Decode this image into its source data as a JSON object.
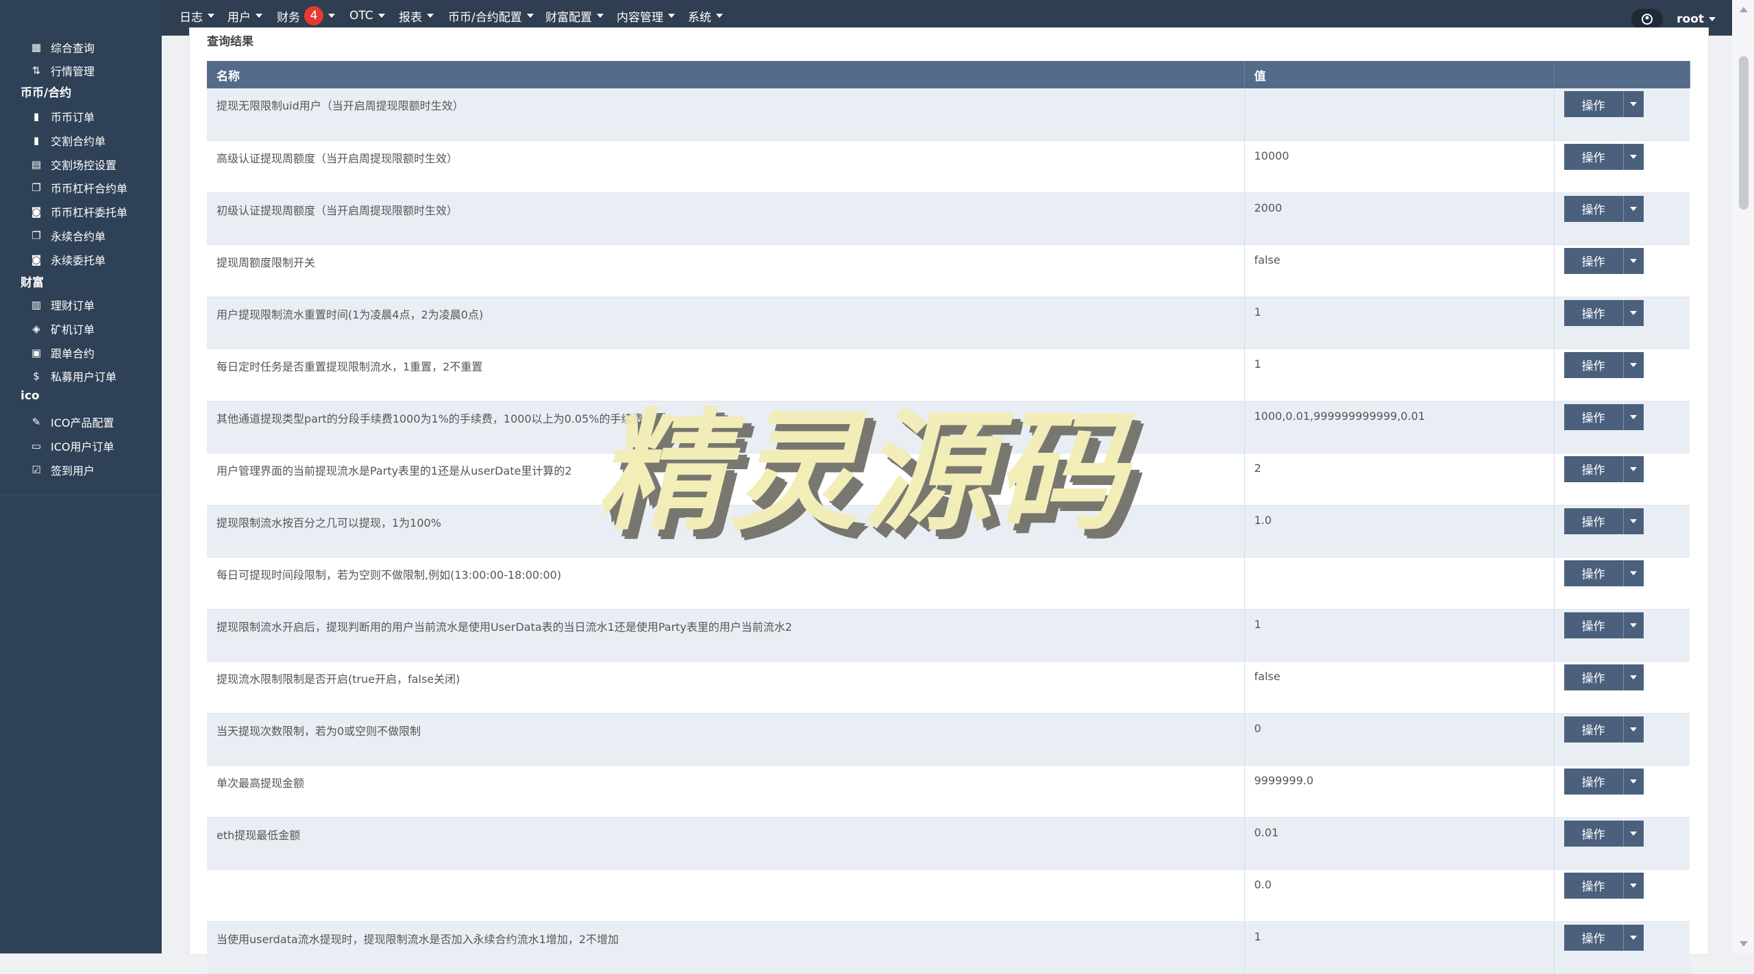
{
  "sidebar": {
    "items_top": [
      {
        "label": "综合查询",
        "icon": "grid-icon"
      },
      {
        "label": "行情管理",
        "icon": "sort-icon"
      }
    ],
    "section_coin": "币币/合约",
    "items_coin": [
      {
        "label": "币币订单",
        "icon": "bookmark-icon"
      },
      {
        "label": "交割合约单",
        "icon": "bookmark-icon"
      },
      {
        "label": "交割场控设置",
        "icon": "file-icon"
      },
      {
        "label": "币币杠杆合约单",
        "icon": "copy-icon"
      },
      {
        "label": "币币杠杆委托单",
        "icon": "file-clock-icon"
      },
      {
        "label": "永续合约单",
        "icon": "copy-icon"
      },
      {
        "label": "永续委托单",
        "icon": "file-clock-icon"
      }
    ],
    "section_wealth": "财富",
    "items_wealth": [
      {
        "label": "理财订单",
        "icon": "database-icon"
      },
      {
        "label": "矿机订单",
        "icon": "layers-icon"
      },
      {
        "label": "跟单合约",
        "icon": "calendar-icon"
      },
      {
        "label": "私募用户订单",
        "icon": "dollar-icon"
      }
    ],
    "section_ico": "ico",
    "items_ico": [
      {
        "label": "ICO产品配置",
        "icon": "edit-icon"
      },
      {
        "label": "ICO用户订单",
        "icon": "message-icon"
      },
      {
        "label": "签到用户",
        "icon": "check-edit-icon"
      }
    ]
  },
  "topnav": {
    "menus": [
      "日志",
      "用户",
      "财务",
      "OTC",
      "报表",
      "币币/合约配置",
      "财富配置",
      "内容管理",
      "系统"
    ],
    "finance_badge": "4",
    "user": "root",
    "avatar_icon": "user-circle-icon"
  },
  "results": {
    "title": "查询结果",
    "col_name": "名称",
    "col_value": "值",
    "col_action": "",
    "action_label": "操作",
    "rows": [
      {
        "name": "提现无限限制uid用户（当开启周提现限额时生效）",
        "value": ""
      },
      {
        "name": "高级认证提现周额度（当开启周提现限额时生效）",
        "value": "10000"
      },
      {
        "name": "初级认证提现周额度（当开启周提现限额时生效）",
        "value": "2000"
      },
      {
        "name": "提现周额度限制开关",
        "value": "false"
      },
      {
        "name": "用户提现限制流水重置时间(1为凌晨4点，2为凌晨0点)",
        "value": "1"
      },
      {
        "name": "每日定时任务是否重置提现限制流水，1重置，2不重置",
        "value": "1"
      },
      {
        "name": "其他通道提现类型part的分段手续费1000为1%的手续费，1000以上为0.05%的手续费",
        "value": "1000,0.01,999999999999,0.01"
      },
      {
        "name": "用户管理界面的当前提现流水是Party表里的1还是从userDate里计算的2",
        "value": "2"
      },
      {
        "name": "提现限制流水按百分之几可以提现，1为100%",
        "value": "1.0"
      },
      {
        "name": "每日可提现时间段限制，若为空则不做限制,例如(13:00:00-18:00:00)",
        "value": ""
      },
      {
        "name": "提现限制流水开启后，提现判断用的用户当前流水是使用UserData表的当日流水1还是使用Party表里的用户当前流水2",
        "value": "1"
      },
      {
        "name": "提现流水限制限制是否开启(true开启，false关闭)",
        "value": "false"
      },
      {
        "name": "当天提现次数限制，若为0或空则不做限制",
        "value": "0"
      },
      {
        "name": "单次最高提现金额",
        "value": "9999999.0"
      },
      {
        "name": "eth提现最低金额",
        "value": "0.01"
      },
      {
        "name": "",
        "value": "0.0"
      },
      {
        "name": "当使用userdata流水提现时，提现限制流水是否加入永续合约流水1增加，2不增加",
        "value": "1"
      }
    ]
  },
  "watermark": "精灵源码"
}
